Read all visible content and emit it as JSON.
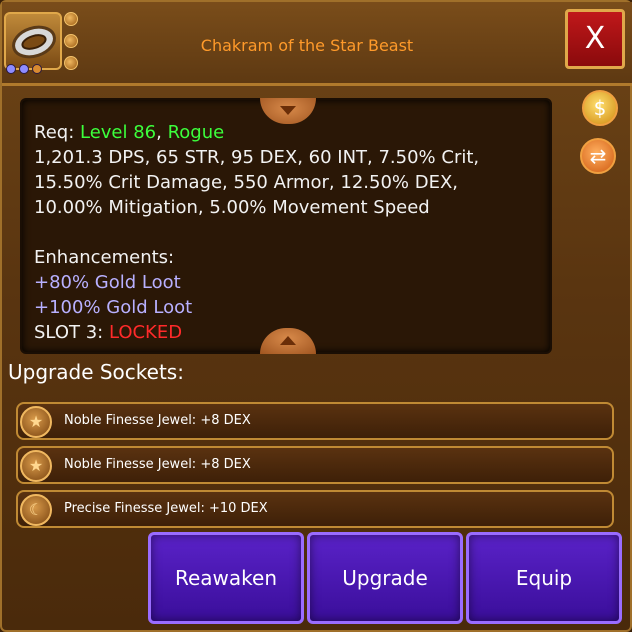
{
  "item": {
    "title": "Chakram of the Star Beast",
    "icon": "chakram-icon",
    "slot_dots": [
      "#8e8cff",
      "#8e8cff",
      "#d88a30"
    ]
  },
  "close_label": "X",
  "side_icons": [
    "gold-bag-icon",
    "swap-icon"
  ],
  "stats": {
    "req_prefix": "Req: ",
    "req_level": "Level 86",
    "req_sep": ", ",
    "req_class": "Rogue",
    "line1": "1,201.3 DPS, 65 STR, 95 DEX, 60 INT, 7.50% Crit,",
    "line2": "15.50% Crit Damage, 550 Armor, 12.50% DEX,",
    "line3": "10.00% Mitigation, 5.00% Movement Speed",
    "enh_heading": "Enhancements:",
    "enh1": "+80% Gold Loot",
    "enh2": "+100% Gold Loot",
    "slot3_prefix": "SLOT 3: ",
    "slot3_status": "LOCKED"
  },
  "sockets_heading": "Upgrade Sockets:",
  "sockets": [
    {
      "label": "Noble Finesse Jewel: +8 DEX",
      "icon": "star-icon"
    },
    {
      "label": "Noble Finesse Jewel: +8 DEX",
      "icon": "star-icon"
    },
    {
      "label": "Precise Finesse Jewel: +10 DEX",
      "icon": "moon-icon"
    }
  ],
  "buttons": {
    "reawaken": "Reawaken",
    "upgrade": "Upgrade",
    "equip": "Equip"
  },
  "colors": {
    "title": "#ff9a2a",
    "req_highlight": "#3cff3c",
    "enhancement": "#b8b0ff",
    "locked": "#ff2a2a",
    "button": "#4a16b0"
  }
}
